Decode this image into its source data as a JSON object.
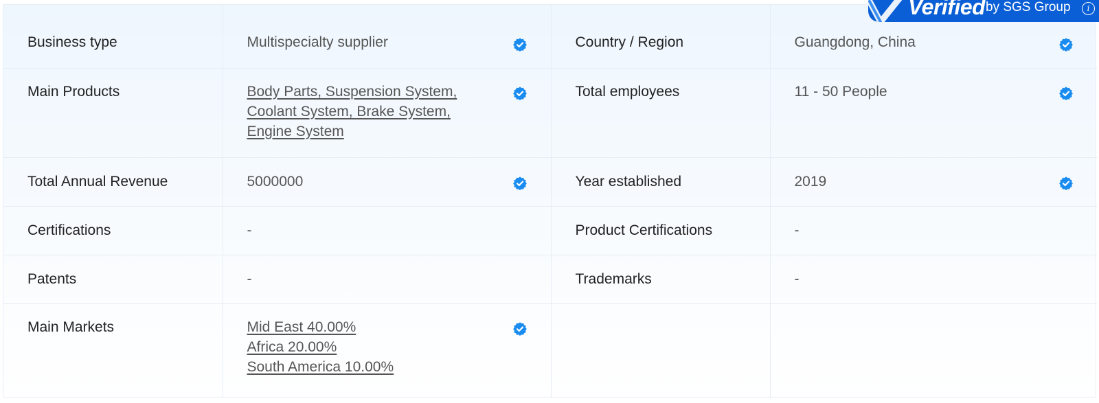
{
  "badge": {
    "verified_text": "Verified",
    "by_text": "by SGS Group",
    "info_glyph": "i",
    "icon": "sgs-check-mark-icon",
    "color": "#0a5fd6"
  },
  "verified_icon": {
    "name": "verified-badge-icon",
    "color": "#1a8cf0"
  },
  "rows": [
    {
      "left": {
        "label": "Business type",
        "value": "Multispecialty supplier",
        "verified": true
      },
      "right": {
        "label": "Country / Region",
        "value": "Guangdong, China",
        "verified": true
      }
    },
    {
      "left": {
        "label": "Main Products",
        "links": [
          "Body Parts, Suspension System,",
          "Coolant System, Brake System,",
          "Engine System"
        ],
        "verified": true
      },
      "right": {
        "label": "Total employees",
        "value": "11 - 50 People",
        "verified": true
      }
    },
    {
      "left": {
        "label": "Total Annual Revenue",
        "value": "5000000",
        "verified": true
      },
      "right": {
        "label": "Year established",
        "value": "2019",
        "verified": true
      }
    },
    {
      "left": {
        "label": "Certifications",
        "value": "-"
      },
      "right": {
        "label": "Product Certifications",
        "value": "-"
      }
    },
    {
      "left": {
        "label": "Patents",
        "value": "-"
      },
      "right": {
        "label": "Trademarks",
        "value": "-"
      }
    },
    {
      "left": {
        "label": "Main Markets",
        "links": [
          "Mid East 40.00%",
          "Africa 20.00%",
          "South America 10.00%"
        ],
        "verified": true
      }
    }
  ]
}
